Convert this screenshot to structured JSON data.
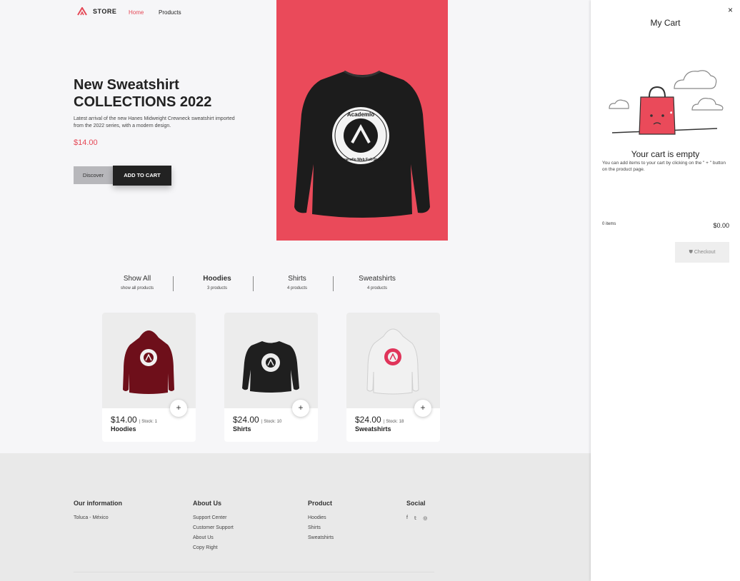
{
  "header": {
    "brand": "STORE",
    "nav": {
      "home": "Home",
      "products": "Products"
    },
    "cart_count": "0"
  },
  "hero": {
    "title": "New Sweatshirt COLLECTIONS 2022",
    "description": "Latest arrival of the new Hanes Midweight Crewneck sweatshirt imported from the 2022 series, with a modern design.",
    "price": "$14.00",
    "discover_label": "Discover",
    "add_label": "ADD TO CART",
    "image_text_top": "Academlo",
    "image_text_bottom": "Desarrollo Web Full-Stack",
    "accent_color": "#ea4a5a"
  },
  "categories": [
    {
      "name": "Show All",
      "count": "show all products"
    },
    {
      "name": "Hoodies",
      "count": "3 products"
    },
    {
      "name": "Shirts",
      "count": "4 products"
    },
    {
      "name": "Sweatshirts",
      "count": "4 products"
    }
  ],
  "products": [
    {
      "price": "$14.00",
      "stock": "| Stock: 1",
      "name": "Hoodies",
      "color": "#6e0f1a",
      "plus": "+"
    },
    {
      "price": "$24.00",
      "stock": "| Stock: 10",
      "name": "Shirts",
      "color": "#1f1f1f",
      "plus": "+"
    },
    {
      "price": "$24.00",
      "stock": "| Stock: 18",
      "name": "Sweatshirts",
      "color": "#e3e3e3",
      "plus": "+"
    }
  ],
  "footer": {
    "info": {
      "title": "Our information",
      "location": "Toluca - México"
    },
    "about": {
      "title": "About Us",
      "links": [
        "Support Center",
        "Customer Support",
        "About Us",
        "Copy Right"
      ]
    },
    "product": {
      "title": "Product",
      "links": [
        "Hoodies",
        "Shirts",
        "Sweatshirts"
      ]
    },
    "social": {
      "title": "Social",
      "icons": [
        "f",
        "𝕥",
        "◎"
      ]
    }
  },
  "cart": {
    "close": "×",
    "title": "My Cart",
    "empty_title": "Your cart is empty",
    "empty_desc": "You can add items to your cart by clicking on the \" + \" button on the product page.",
    "items": "0 items",
    "total": "$0.00",
    "checkout": "Checkout",
    "bag_color": "#ea4a5a"
  }
}
